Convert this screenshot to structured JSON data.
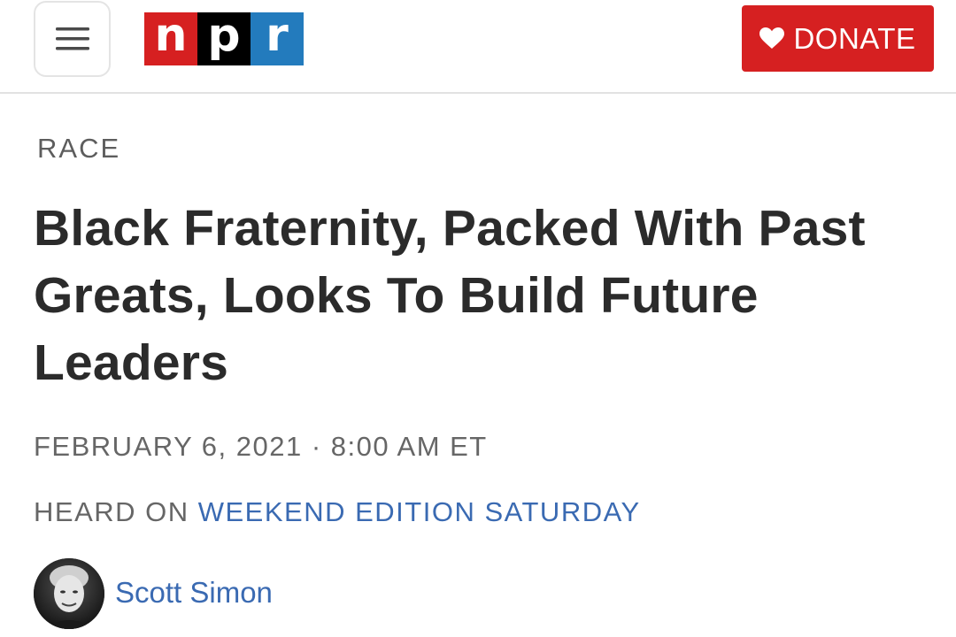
{
  "header": {
    "menu_icon": "hamburger-menu-icon",
    "logo": {
      "letters": [
        "n",
        "p",
        "r"
      ],
      "colors": [
        "#d62021",
        "#000000",
        "#237bbd"
      ]
    },
    "donate_label": "DONATE",
    "donate_icon": "heart-icon",
    "donate_color": "#d62021"
  },
  "article": {
    "section": "RACE",
    "headline": "Black Fraternity, Packed With Past Greats, Looks To Build Future Leaders",
    "dateline": "FEBRUARY 6, 2021 · 8:00 AM ET",
    "heard_on_prefix": "HEARD ON ",
    "program": "WEEKEND EDITION SATURDAY",
    "author": "Scott Simon",
    "link_color": "#3a6ab2"
  }
}
